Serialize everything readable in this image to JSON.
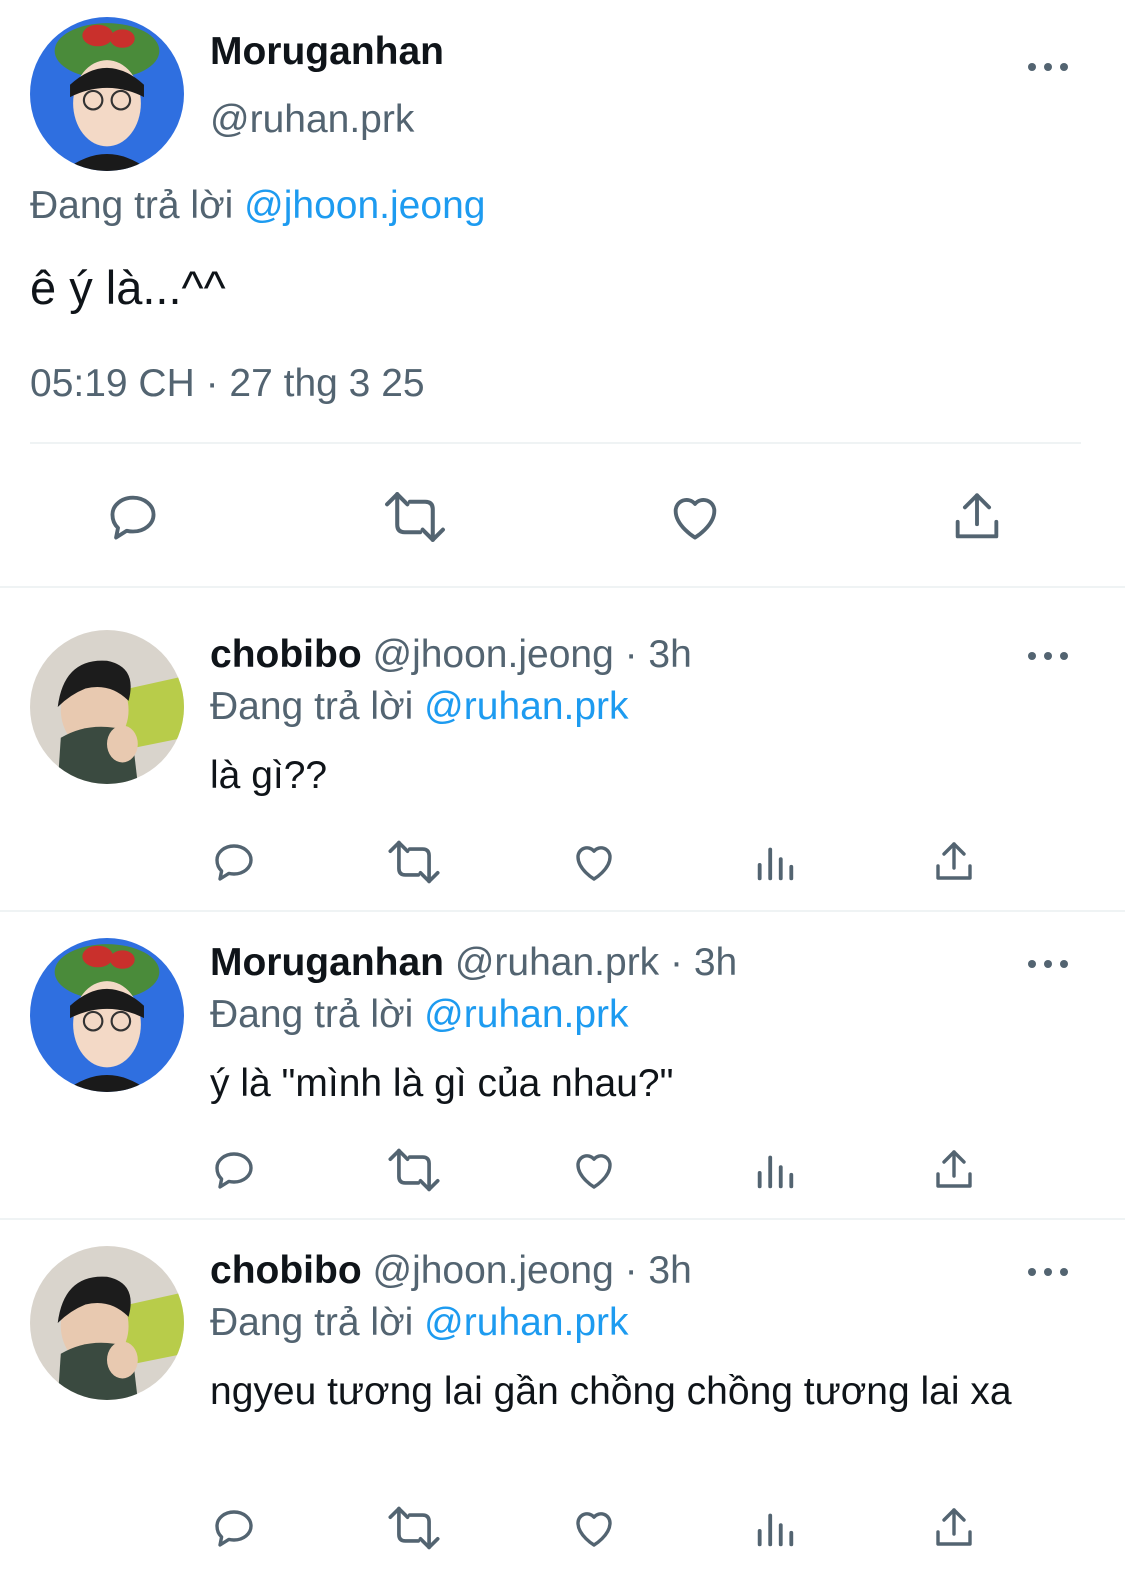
{
  "main_tweet": {
    "display_name": "Moruganhan",
    "handle": "@ruhan.prk",
    "replying_prefix": "Đang trả lời",
    "replying_to": "@jhoon.jeong",
    "text": "ê ý là...^^",
    "timestamp": "05:19 CH · 27 thg 3 25"
  },
  "replies": [
    {
      "display_name": "chobibo",
      "handle_time": "@jhoon.jeong · 3h",
      "replying_prefix": "Đang trả lời",
      "replying_to": "@ruhan.prk",
      "text": "là gì??"
    },
    {
      "display_name": "Moruganhan",
      "handle_time": "@ruhan.prk · 3h",
      "replying_prefix": "Đang trả lời",
      "replying_to": "@ruhan.prk",
      "text": "ý là \"mình là gì của nhau?\""
    },
    {
      "display_name": "chobibo",
      "handle_time": "@jhoon.jeong · 3h",
      "replying_prefix": "Đang trả lời",
      "replying_to": "@ruhan.prk",
      "text": "ngyeu tương lai gần chồng chồng tương lai xa"
    }
  ],
  "icons": {
    "reply": "reply-icon",
    "retweet": "retweet-icon",
    "like": "heart-icon",
    "views": "views-icon",
    "share": "share-icon",
    "more": "more-icon"
  },
  "colors": {
    "link": "#1d9bf0",
    "secondary_text": "#536471",
    "divider": "#eff3f4"
  }
}
